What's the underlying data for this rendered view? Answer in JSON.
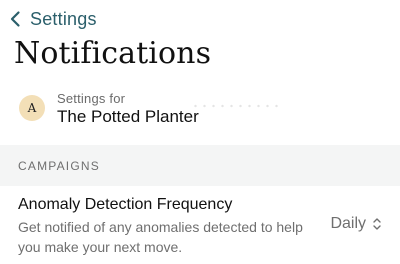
{
  "nav": {
    "back_label": "Settings"
  },
  "page": {
    "title": "Notifications"
  },
  "settings_for": {
    "label": "Settings for",
    "shop_name": "The Potted Planter",
    "avatar_initial": "A"
  },
  "sections": {
    "campaigns": {
      "header": "CAMPAIGNS",
      "row": {
        "title": "Anomaly Detection Frequency",
        "description": "Get notified of any anomalies detected to help you make your next move.",
        "selected_value": "Daily"
      }
    }
  },
  "colors": {
    "accent": "#2b5f6b",
    "avatar_bg": "#f3dfb7",
    "section_bg": "#f4f5f5"
  }
}
